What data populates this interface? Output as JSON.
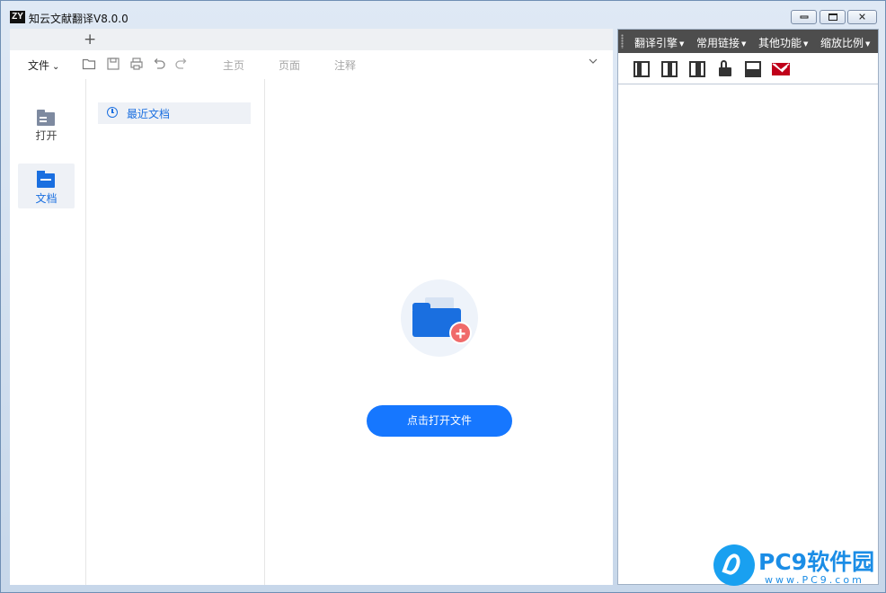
{
  "window": {
    "logo_text": "ZY",
    "title": "知云文献翻译V8.0.0"
  },
  "tabstrip": {
    "new_tab": "+"
  },
  "toolbar": {
    "file_menu": "文件",
    "tabs": [
      "主页",
      "页面",
      "注释"
    ],
    "icons": [
      "open-folder-icon",
      "save-icon",
      "print-icon",
      "undo-icon",
      "redo-icon"
    ]
  },
  "sidebar": {
    "items": [
      {
        "label": "打开",
        "icon": "folder-icon"
      },
      {
        "label": "文档",
        "icon": "document-folder-icon",
        "selected": true
      }
    ]
  },
  "recent": {
    "label": "最近文档",
    "icon": "clock-icon"
  },
  "empty_state": {
    "icon": "folder-add-icon",
    "button_label": "点击打开文件"
  },
  "right_panel": {
    "menus": [
      "翻译引擎",
      "常用链接",
      "其他功能",
      "缩放比例"
    ],
    "icons": [
      "book-left-icon",
      "book-right-icon",
      "book-split-icon",
      "unlock-icon",
      "window-icon",
      "mail-icon"
    ]
  },
  "watermark": {
    "title": "PC9软件园",
    "url": "www.PC9.com"
  },
  "colors": {
    "accent": "#1677ff",
    "badge": "#f06a6a",
    "menubar": "#4d4d4d",
    "mail": "#c0001a"
  }
}
